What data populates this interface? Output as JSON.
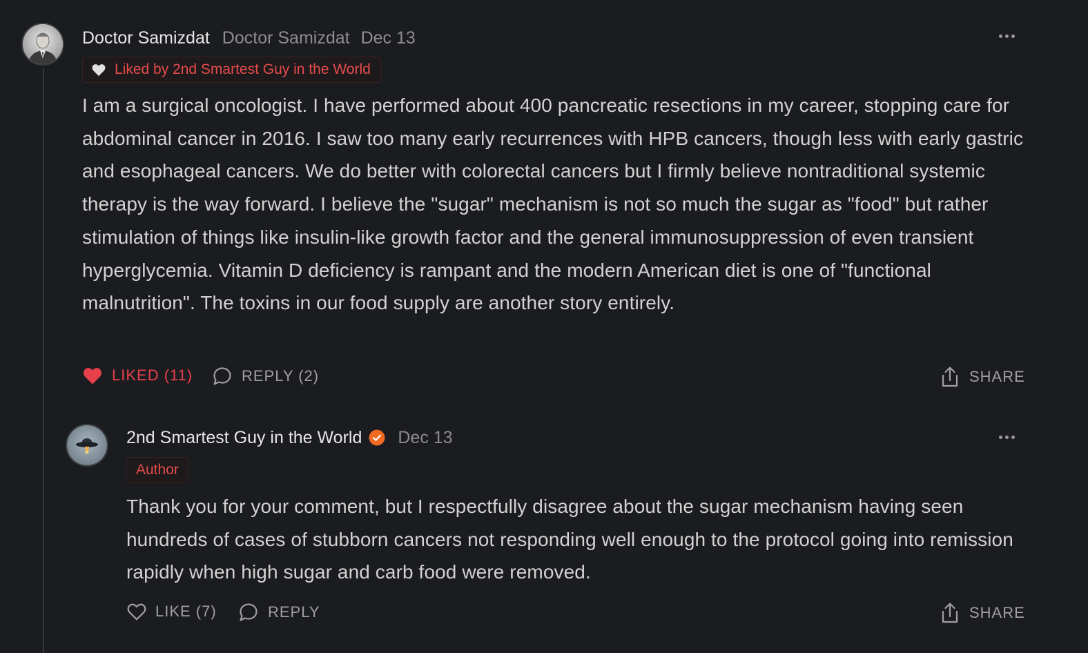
{
  "comment": {
    "author": "Doctor Samizdat",
    "handle": "Doctor Samizdat",
    "date": "Dec 13",
    "liked_by": "Liked by 2nd Smartest Guy in the World",
    "body": "I am a surgical oncologist. I have performed about 400 pancreatic resections in my career, stopping care for abdominal cancer in 2016. I saw too many early recurrences with HPB cancers, though less with early gastric and esophageal cancers. We do better with colorectal cancers but I firmly believe nontraditional systemic therapy is the way forward. I believe the \"sugar\" mechanism is not so much the sugar as \"food\" but rather stimulation of things like insulin-like growth factor and the general immunosuppression of even transient hyperglycemia. Vitamin D deficiency is rampant and the modern American diet is one of \"functional malnutrition\". The toxins in our food supply are another story entirely.",
    "like_label": "LIKED (11)",
    "reply_label": "REPLY (2)",
    "share_label": "SHARE",
    "like_icon": "heart-filled-icon"
  },
  "reply": {
    "author": "2nd Smartest Guy in the World",
    "verified_icon": "verified-check-icon",
    "date": "Dec 13",
    "author_badge": "Author",
    "body": "Thank you for your comment, but I respectfully disagree about the sugar mechanism having seen hundreds of cases of stubborn cancers not responding well enough to the protocol going into remission rapidly when high sugar and carb food were removed.",
    "like_label": "LIKE (7)",
    "reply_label": "REPLY",
    "share_label": "SHARE",
    "like_icon": "heart-outline-icon"
  },
  "colors": {
    "background": "#1b1c1f",
    "accent_red": "#e8404a",
    "verified_orange": "#ef6a22",
    "muted_text": "#8d8d8d"
  }
}
